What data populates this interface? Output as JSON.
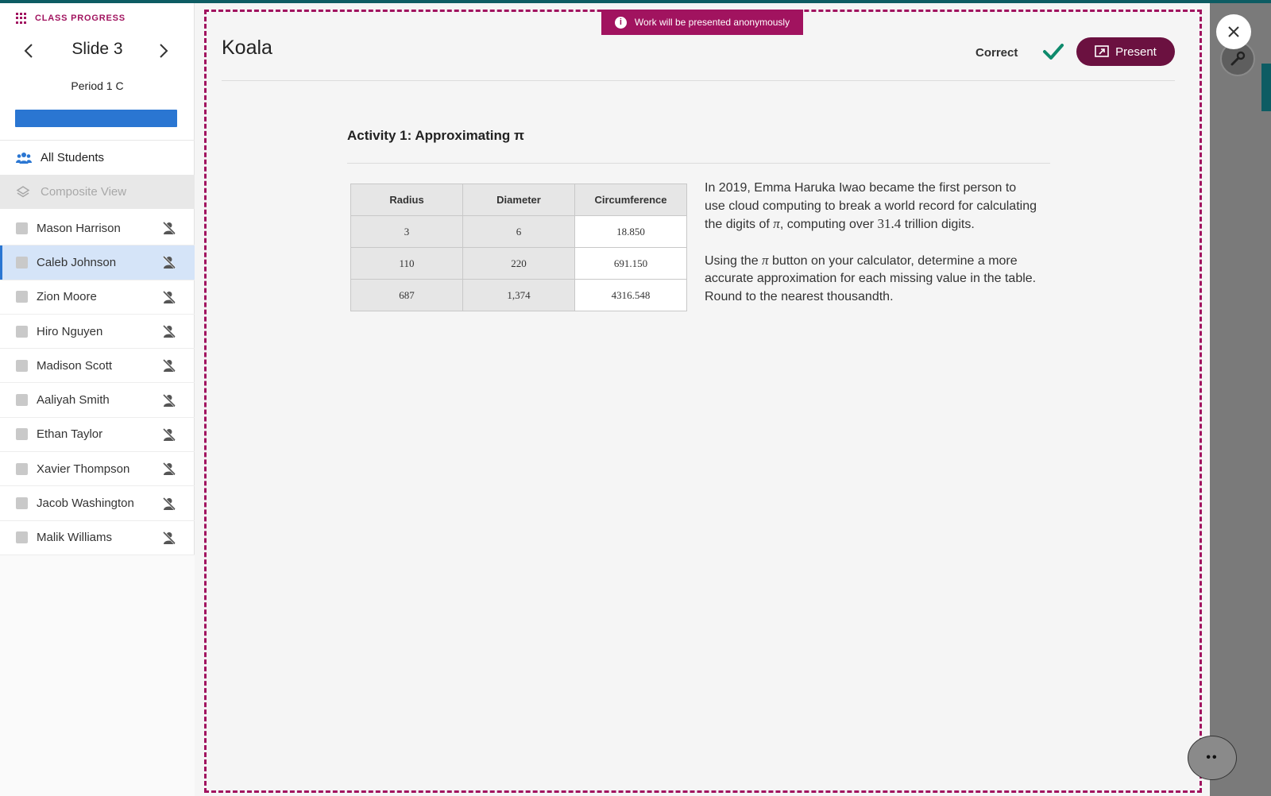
{
  "sidebar": {
    "header_label": "CLASS PROGRESS",
    "slide_title": "Slide 3",
    "period": "Period 1 C",
    "all_students_label": "All Students",
    "composite_label": "Composite View",
    "students": [
      {
        "name": "Mason Harrison",
        "selected": false
      },
      {
        "name": "Caleb Johnson",
        "selected": true
      },
      {
        "name": "Zion Moore",
        "selected": false
      },
      {
        "name": "Hiro Nguyen",
        "selected": false
      },
      {
        "name": "Madison Scott",
        "selected": false
      },
      {
        "name": "Aaliyah Smith",
        "selected": false
      },
      {
        "name": "Ethan Taylor",
        "selected": false
      },
      {
        "name": "Xavier Thompson",
        "selected": false
      },
      {
        "name": "Jacob Washington",
        "selected": false
      },
      {
        "name": "Malik Williams",
        "selected": false
      }
    ],
    "icons": {
      "grid": "grid-icon",
      "prev": "chevron-left-icon",
      "next": "chevron-right-icon",
      "students": "people-icon",
      "composite": "layers-icon",
      "hidden": "eye-off-icon"
    }
  },
  "main": {
    "banner": "Work will be presented anonymously",
    "student_title": "Koala",
    "correct_label": "Correct",
    "present_label": "Present",
    "activity_title": "Activity 1:  Approximating π",
    "table": {
      "headers": [
        "Radius",
        "Diameter",
        "Circumference"
      ],
      "rows": [
        [
          "3",
          "6",
          "18.850"
        ],
        [
          "110",
          "220",
          "691.150"
        ],
        [
          "687",
          "1,374",
          "4316.548"
        ]
      ]
    },
    "description": {
      "p1_a": "In 2019, Emma Haruka Iwao became the first person to use cloud computing to break a world record for calculating the digits of ",
      "pi": "π",
      "p1_b": ", computing over ",
      "p1_num": "31.4",
      "p1_c": " trillion digits.",
      "p2_a": "Using the ",
      "p2_b": " button on your calculator, determine a more accurate approximation for each missing value in the table. Round to the nearest thousandth."
    }
  },
  "colors": {
    "accent": "#a1135f",
    "present": "#6b1140",
    "progress": "#2a76d2",
    "correct": "#0e8a6c"
  },
  "more_label": "••"
}
